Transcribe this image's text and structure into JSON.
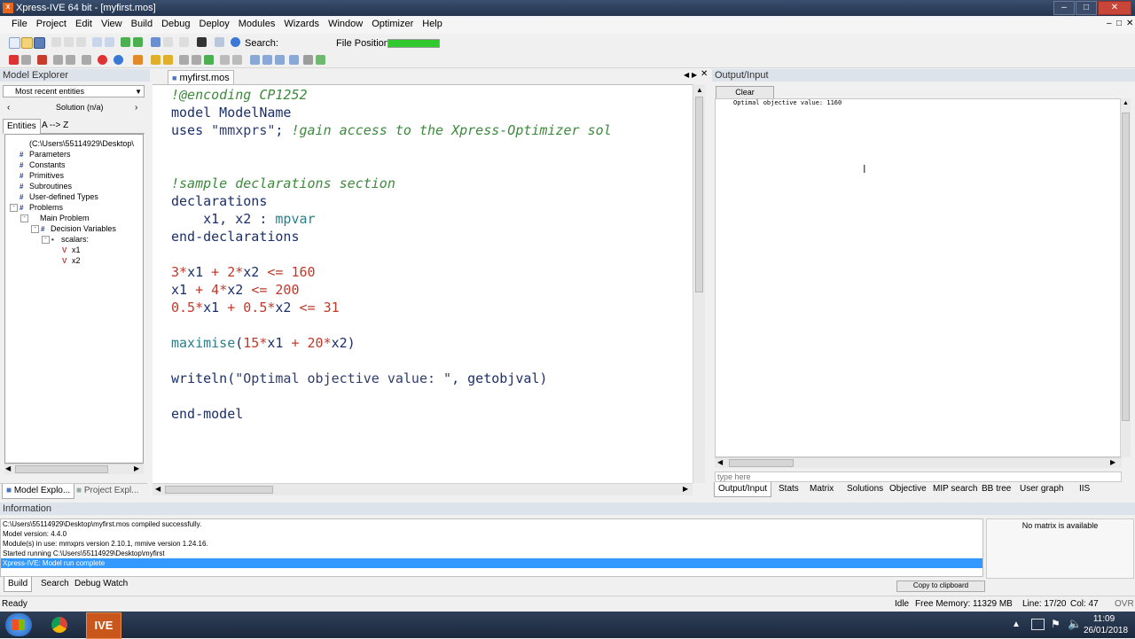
{
  "window": {
    "title": "Xpress-IVE 64 bit - [myfirst.mos]",
    "app_icon_text": "IVE"
  },
  "menu": [
    "File",
    "Project",
    "Edit",
    "View",
    "Build",
    "Debug",
    "Deploy",
    "Modules",
    "Wizards",
    "Window",
    "Optimizer",
    "Help"
  ],
  "toolbar": {
    "search_label": "Search:",
    "file_position_label": "File Position:"
  },
  "model_explorer": {
    "title": "Model Explorer",
    "dropdown_value": "Most recent entities",
    "solution_label": "Solution (n/a)",
    "tabs": [
      "Entities",
      "A --> Z"
    ],
    "tree": [
      {
        "label": "(C:\\Users\\55114929\\Desktop\\",
        "level": 1,
        "icon": "none",
        "toggle": ""
      },
      {
        "label": "Parameters",
        "level": 1,
        "icon": "hash-icon",
        "toggle": ""
      },
      {
        "label": "Constants",
        "level": 1,
        "icon": "hash-icon",
        "toggle": ""
      },
      {
        "label": "Primitives",
        "level": 1,
        "icon": "hash-icon",
        "toggle": ""
      },
      {
        "label": "Subroutines",
        "level": 1,
        "icon": "hash-icon",
        "toggle": ""
      },
      {
        "label": "User-defined Types",
        "level": 1,
        "icon": "hash-icon",
        "toggle": ""
      },
      {
        "label": "Problems",
        "level": 1,
        "icon": "hash-icon",
        "toggle": "-"
      },
      {
        "label": "Main Problem",
        "level": 2,
        "icon": "none",
        "toggle": "-"
      },
      {
        "label": "Decision Variables",
        "level": 3,
        "icon": "hash-icon",
        "toggle": "-"
      },
      {
        "label": "scalars:",
        "level": 4,
        "icon": "dot-icon",
        "toggle": "-"
      },
      {
        "label": "x1",
        "level": 5,
        "icon": "variable-icon",
        "toggle": ""
      },
      {
        "label": "x2",
        "level": 5,
        "icon": "variable-icon",
        "toggle": ""
      }
    ],
    "bottom_tabs": [
      "Model Explo...",
      "Project Expl..."
    ]
  },
  "editor": {
    "tab_label": "myfirst.mos",
    "lines": [
      [
        {
          "t": "!@encoding CP1252",
          "c": "cm"
        }
      ],
      [
        {
          "t": "model ModelName",
          "c": "kw"
        }
      ],
      [
        {
          "t": "uses ",
          "c": "kw"
        },
        {
          "t": "\"mmxprs\"",
          "c": "str"
        },
        {
          "t": "; ",
          "c": "kw"
        },
        {
          "t": "!gain access to the Xpress-Optimizer sol",
          "c": "cm"
        }
      ],
      [],
      [],
      [
        {
          "t": "!sample declarations section",
          "c": "cm"
        }
      ],
      [
        {
          "t": "declarations",
          "c": "kw"
        }
      ],
      [
        {
          "t": "    x1, x2 : ",
          "c": "kw"
        },
        {
          "t": "mpvar",
          "c": "fn"
        }
      ],
      [
        {
          "t": "end-declarations",
          "c": "kw"
        }
      ],
      [],
      [
        {
          "t": "3",
          "c": "num"
        },
        {
          "t": "*",
          "c": "op"
        },
        {
          "t": "x1 ",
          "c": "kw"
        },
        {
          "t": "+ ",
          "c": "op"
        },
        {
          "t": "2",
          "c": "num"
        },
        {
          "t": "*",
          "c": "op"
        },
        {
          "t": "x2 ",
          "c": "kw"
        },
        {
          "t": "<= 160",
          "c": "num"
        }
      ],
      [
        {
          "t": "x1 ",
          "c": "kw"
        },
        {
          "t": "+ ",
          "c": "op"
        },
        {
          "t": "4",
          "c": "num"
        },
        {
          "t": "*",
          "c": "op"
        },
        {
          "t": "x2 ",
          "c": "kw"
        },
        {
          "t": "<= 200",
          "c": "num"
        }
      ],
      [
        {
          "t": "0.5",
          "c": "num"
        },
        {
          "t": "*",
          "c": "op"
        },
        {
          "t": "x1 ",
          "c": "kw"
        },
        {
          "t": "+ ",
          "c": "op"
        },
        {
          "t": "0.5",
          "c": "num"
        },
        {
          "t": "*",
          "c": "op"
        },
        {
          "t": "x2 ",
          "c": "kw"
        },
        {
          "t": "<= 31",
          "c": "num"
        }
      ],
      [],
      [
        {
          "t": "maximise",
          "c": "fn"
        },
        {
          "t": "(",
          "c": "kw"
        },
        {
          "t": "15",
          "c": "num"
        },
        {
          "t": "*",
          "c": "op"
        },
        {
          "t": "x1 ",
          "c": "kw"
        },
        {
          "t": "+ ",
          "c": "op"
        },
        {
          "t": "20",
          "c": "num"
        },
        {
          "t": "*",
          "c": "op"
        },
        {
          "t": "x2)",
          "c": "kw"
        }
      ],
      [],
      [
        {
          "t": "writeln(",
          "c": "kw"
        },
        {
          "t": "\"Optimal objective value: \"",
          "c": "str"
        },
        {
          "t": ", getobjval)",
          "c": "kw"
        }
      ],
      [],
      [
        {
          "t": "end-model",
          "c": "kw"
        }
      ]
    ]
  },
  "output": {
    "title": "Output/Input",
    "clear_label": "Clear",
    "text": "Optimal objective value: 1160",
    "input_placeholder": "type here",
    "tabs": [
      "Output/Input",
      "Stats",
      "Matrix",
      "Solutions",
      "Objective",
      "MIP search",
      "BB tree",
      "User graph",
      "IIS"
    ]
  },
  "info": {
    "title": "Information",
    "log": [
      "C:\\Users\\55114929\\Desktop\\myfirst.mos compiled successfully.",
      "Model version: 4.4.0",
      "Module(s) in use: mmxprs version 2.10.1, mmive version 1.24.16.",
      "Started running C:\\Users\\55114929\\Desktop\\myfirst",
      "Xpress-IVE: Model run complete"
    ],
    "matrix_status": "No matrix is available",
    "copy_label": "Copy to clipboard",
    "tabs": [
      "Build",
      "Search",
      "Debug Watch"
    ]
  },
  "status": {
    "ready": "Ready",
    "idle": "Idle",
    "memory": "Free Memory: 11329 MB",
    "position": "Line: 17/20",
    "col": "Col: 47",
    "ovr": "OVR"
  },
  "taskbar": {
    "time": "11:09",
    "date": "26/01/2018"
  },
  "colors": {
    "selection": "#3399ff",
    "progress": "#2fc92f",
    "app_orange": "#e8641b"
  }
}
